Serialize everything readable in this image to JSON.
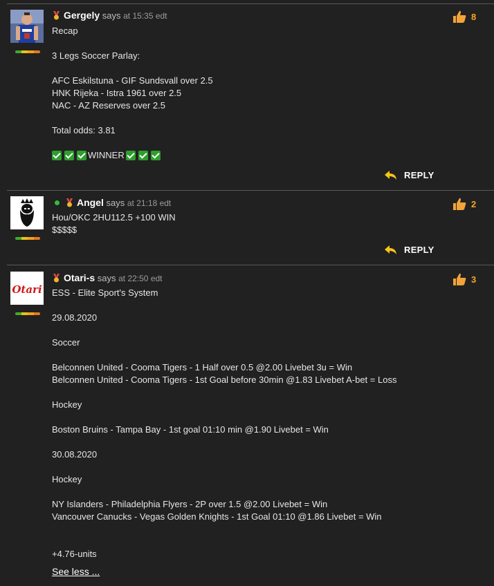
{
  "comments": [
    {
      "author": "Gergely",
      "says": "says",
      "time": "at 15:35 edt",
      "likes": "8",
      "body": "Recap\n\n3 Legs Soccer Parlay:\n\nAFC Eskilstuna - GIF Sundsvall over 2.5\nHNK Rijeka - Istra 1961 over 2.5\nNAC - AZ Reserves over 2.5\n\nTotal odds: 3.81\n",
      "winner_text": "WINNER",
      "reply_label": "REPLY",
      "avatar_icon": "player-photo"
    },
    {
      "author": "Angel",
      "says": "says",
      "time": "at 21:18 edt",
      "likes": "2",
      "body": "Hou/OKC 2HU112.5 +100 WIN\n$$$$$",
      "reply_label": "REPLY",
      "avatar_icon": "bearded-king-icon"
    },
    {
      "author": "Otari-s",
      "says": "says",
      "time": "at 22:50 edt",
      "likes": "3",
      "body": "ESS - Elite Sport's System\n\n29.08.2020\n\nSoccer\n\nBelconnen United - Cooma Tigers - 1 Half over 0.5 @2.00 Livebet 3u = Win\nBelconnen United - Cooma Tigers - 1st Goal before 30min @1.83 Livebet A-bet = Loss\n\nHockey\n\nBoston Bruins - Tampa Bay - 1st goal 01:10 min @1.90 Livebet = Win\n\n30.08.2020\n\nHockey\n\nNY Islanders - Philadelphia Flyers - 2P over 1.5 @2.00 Livebet = Win\nVancouver Canucks - Vegas Golden Knights - 1st Goal 01:10 @1.86 Livebet = Win\n\n\n+4.76-units",
      "avatar_text": "Otari",
      "see_less": "See less ..."
    }
  ],
  "colors": {
    "background": "#212121",
    "like_count": "#f5a623",
    "reply_arrow": "#f5c518",
    "online_dot": "#2fbf3a"
  }
}
